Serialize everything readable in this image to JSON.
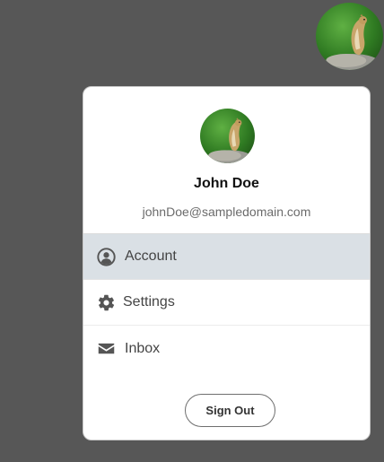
{
  "user": {
    "name": "John Doe",
    "email": "johnDoe@sampledomain.com",
    "avatar_alt": "User avatar"
  },
  "menu": {
    "items": [
      {
        "label": "Account",
        "icon": "account-circle-icon",
        "active": true
      },
      {
        "label": "Settings",
        "icon": "gear-icon",
        "active": false
      },
      {
        "label": "Inbox",
        "icon": "envelope-icon",
        "active": false
      }
    ]
  },
  "actions": {
    "signout_label": "Sign Out"
  },
  "colors": {
    "backdrop": "#575757",
    "active_item_bg": "#dae0e5",
    "icon_color": "#555555"
  }
}
